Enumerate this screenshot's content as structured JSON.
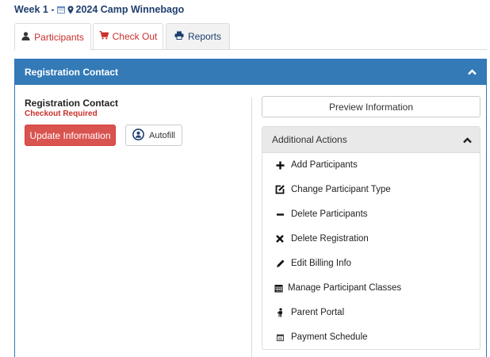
{
  "header": {
    "title_prefix": "Week 1 -",
    "title_main": "2024 Camp Winnebago"
  },
  "tabs": [
    {
      "label": "Participants",
      "icon": "user-icon",
      "active": true
    },
    {
      "label": "Check Out",
      "icon": "cart-icon",
      "active": false
    },
    {
      "label": "Reports",
      "icon": "print-icon",
      "active": false
    }
  ],
  "panel": {
    "title": "Registration Contact",
    "contact_title": "Registration Contact",
    "status": "Checkout Required",
    "update_label": "Update Information",
    "autofill_label": "Autofill",
    "preview_label": "Preview Information"
  },
  "actions": {
    "title": "Additional Actions",
    "items": [
      {
        "label": "Add Participants",
        "icon": "plus-icon"
      },
      {
        "label": "Change Participant Type",
        "icon": "edit-icon"
      },
      {
        "label": "Delete Participants",
        "icon": "minus-icon"
      },
      {
        "label": "Delete Registration",
        "icon": "close-icon"
      },
      {
        "label": "Edit Billing Info",
        "icon": "pencil-icon"
      },
      {
        "label": "Manage Participant Classes",
        "icon": "calendar-icon"
      },
      {
        "label": "Parent Portal",
        "icon": "person-icon"
      },
      {
        "label": "Payment Schedule",
        "icon": "calendar-small-icon"
      }
    ]
  },
  "colors": {
    "primary": "#337ab7",
    "danger": "#d9534f",
    "title": "#1f3f6e"
  }
}
